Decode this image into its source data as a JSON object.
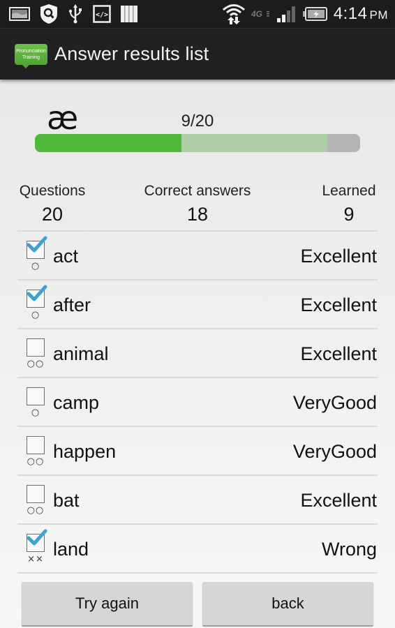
{
  "status_bar": {
    "left_icons": [
      "gallery-notification-icon",
      "security-shield-search-icon",
      "usb-icon",
      "developer-code-icon",
      "barcode-icon"
    ],
    "right_icons": [
      "wifi-data-icon",
      "4g-lte-icon",
      "signal-strength-icon",
      "battery-charging-icon"
    ],
    "network_label": "4G",
    "time": "4:14",
    "ampm": "PM"
  },
  "action_bar": {
    "app_icon_line1": "Pronunciation",
    "app_icon_line2": "Training",
    "title": "Answer results list"
  },
  "session": {
    "phoneme": "æ",
    "progress_text": "9/20",
    "progress_learned": 9,
    "progress_total": 20,
    "progress_secondary_fraction": 0.9,
    "colors": {
      "primary": "#4fba3a",
      "secondary": "#adcda5",
      "track": "#b4b4b4"
    }
  },
  "stats": {
    "questions_label": "Questions",
    "questions_value": "20",
    "correct_label": "Correct answers",
    "correct_value": "18",
    "learned_label": "Learned",
    "learned_value": "9"
  },
  "results": [
    {
      "word": "act",
      "rating": "Excellent",
      "checked": true,
      "marks": "○"
    },
    {
      "word": "after",
      "rating": "Excellent",
      "checked": true,
      "marks": "○"
    },
    {
      "word": "animal",
      "rating": "Excellent",
      "checked": false,
      "marks": "○○"
    },
    {
      "word": "camp",
      "rating": "VeryGood",
      "checked": false,
      "marks": "○"
    },
    {
      "word": "happen",
      "rating": "VeryGood",
      "checked": false,
      "marks": "○○"
    },
    {
      "word": "bat",
      "rating": "Excellent",
      "checked": false,
      "marks": "○○"
    },
    {
      "word": "land",
      "rating": "Wrong",
      "checked": true,
      "marks": "××"
    }
  ],
  "buttons": {
    "try_again": "Try again",
    "back": "back"
  }
}
